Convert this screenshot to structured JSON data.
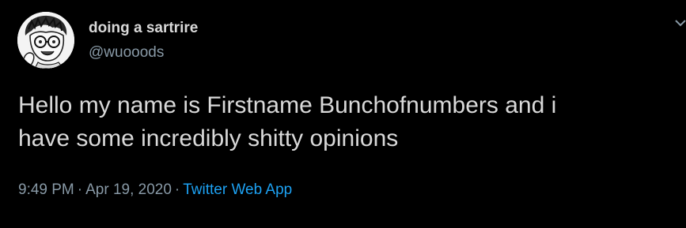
{
  "tweet": {
    "author": {
      "display_name": "doing a sartrire",
      "handle": "@wuooods",
      "avatar_icon": "cartoon-person-avatar-icon"
    },
    "text": "Hello my name is Firstname Bunchofnumbers and i\nhave some incredibly shitty opinions",
    "meta": {
      "time": "9:49 PM",
      "separator": "·",
      "date": "Apr 19, 2020",
      "source": "Twitter Web App"
    }
  },
  "colors": {
    "background": "#000000",
    "primary_text": "#d9d9d9",
    "secondary_text": "#8899a6",
    "link": "#1da1f2"
  }
}
